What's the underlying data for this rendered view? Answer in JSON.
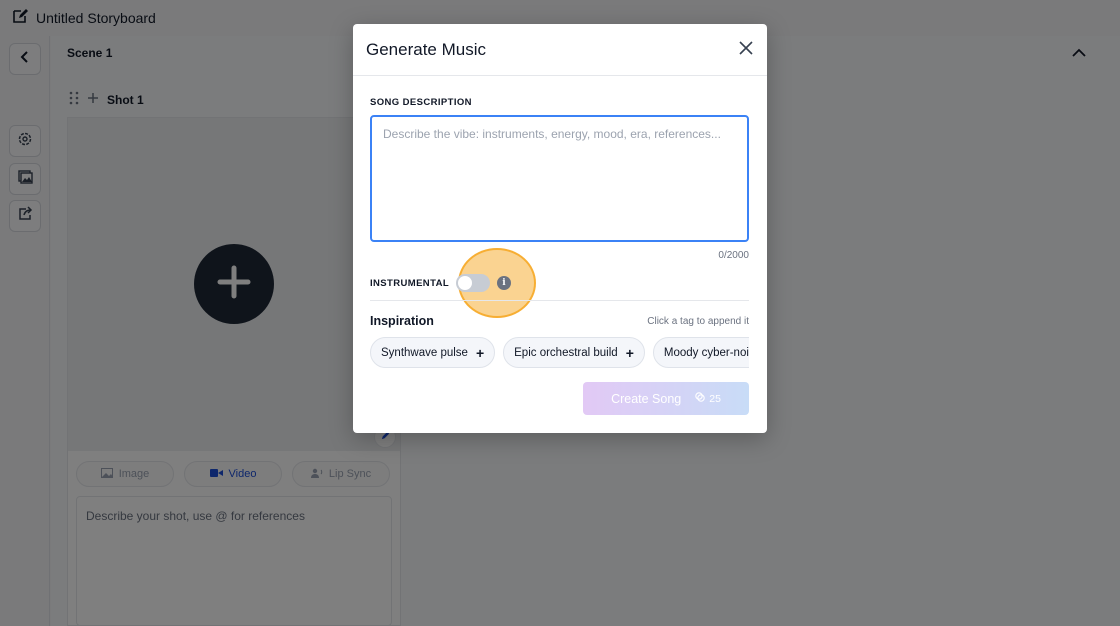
{
  "app": {
    "document_title": "Untitled Storyboard"
  },
  "scene": {
    "title": "Scene 1",
    "shot_title": "Shot 1",
    "modes": [
      {
        "label": "Image",
        "icon": "image-icon",
        "active": false
      },
      {
        "label": "Video",
        "icon": "video-icon",
        "active": true
      },
      {
        "label": "Lip Sync",
        "icon": "lip-sync-icon",
        "active": false
      }
    ],
    "shot_prompt_placeholder": "Describe your shot, use @ for references"
  },
  "modal": {
    "title": "Generate Music",
    "song_description_label": "SONG DESCRIPTION",
    "song_description_placeholder": "Describe the vibe: instruments, energy, mood, era, references...",
    "song_description_value": "",
    "char_count": "0/2000",
    "instrumental_label": "INSTRUMENTAL",
    "instrumental_on": false,
    "inspiration_title": "Inspiration",
    "inspiration_hint": "Click a tag to append it",
    "tags": [
      {
        "label": "Synthwave pulse"
      },
      {
        "label": "Epic orchestral build"
      },
      {
        "label": "Moody cyber-noir"
      }
    ],
    "create_button_label": "Create Song",
    "create_cost": "25"
  },
  "colors": {
    "accent_blue": "#3b82f6",
    "highlight_orange": "#f59e0b",
    "create_gradient_start": "#e2c9f5",
    "create_gradient_end": "#c8dcf7"
  }
}
